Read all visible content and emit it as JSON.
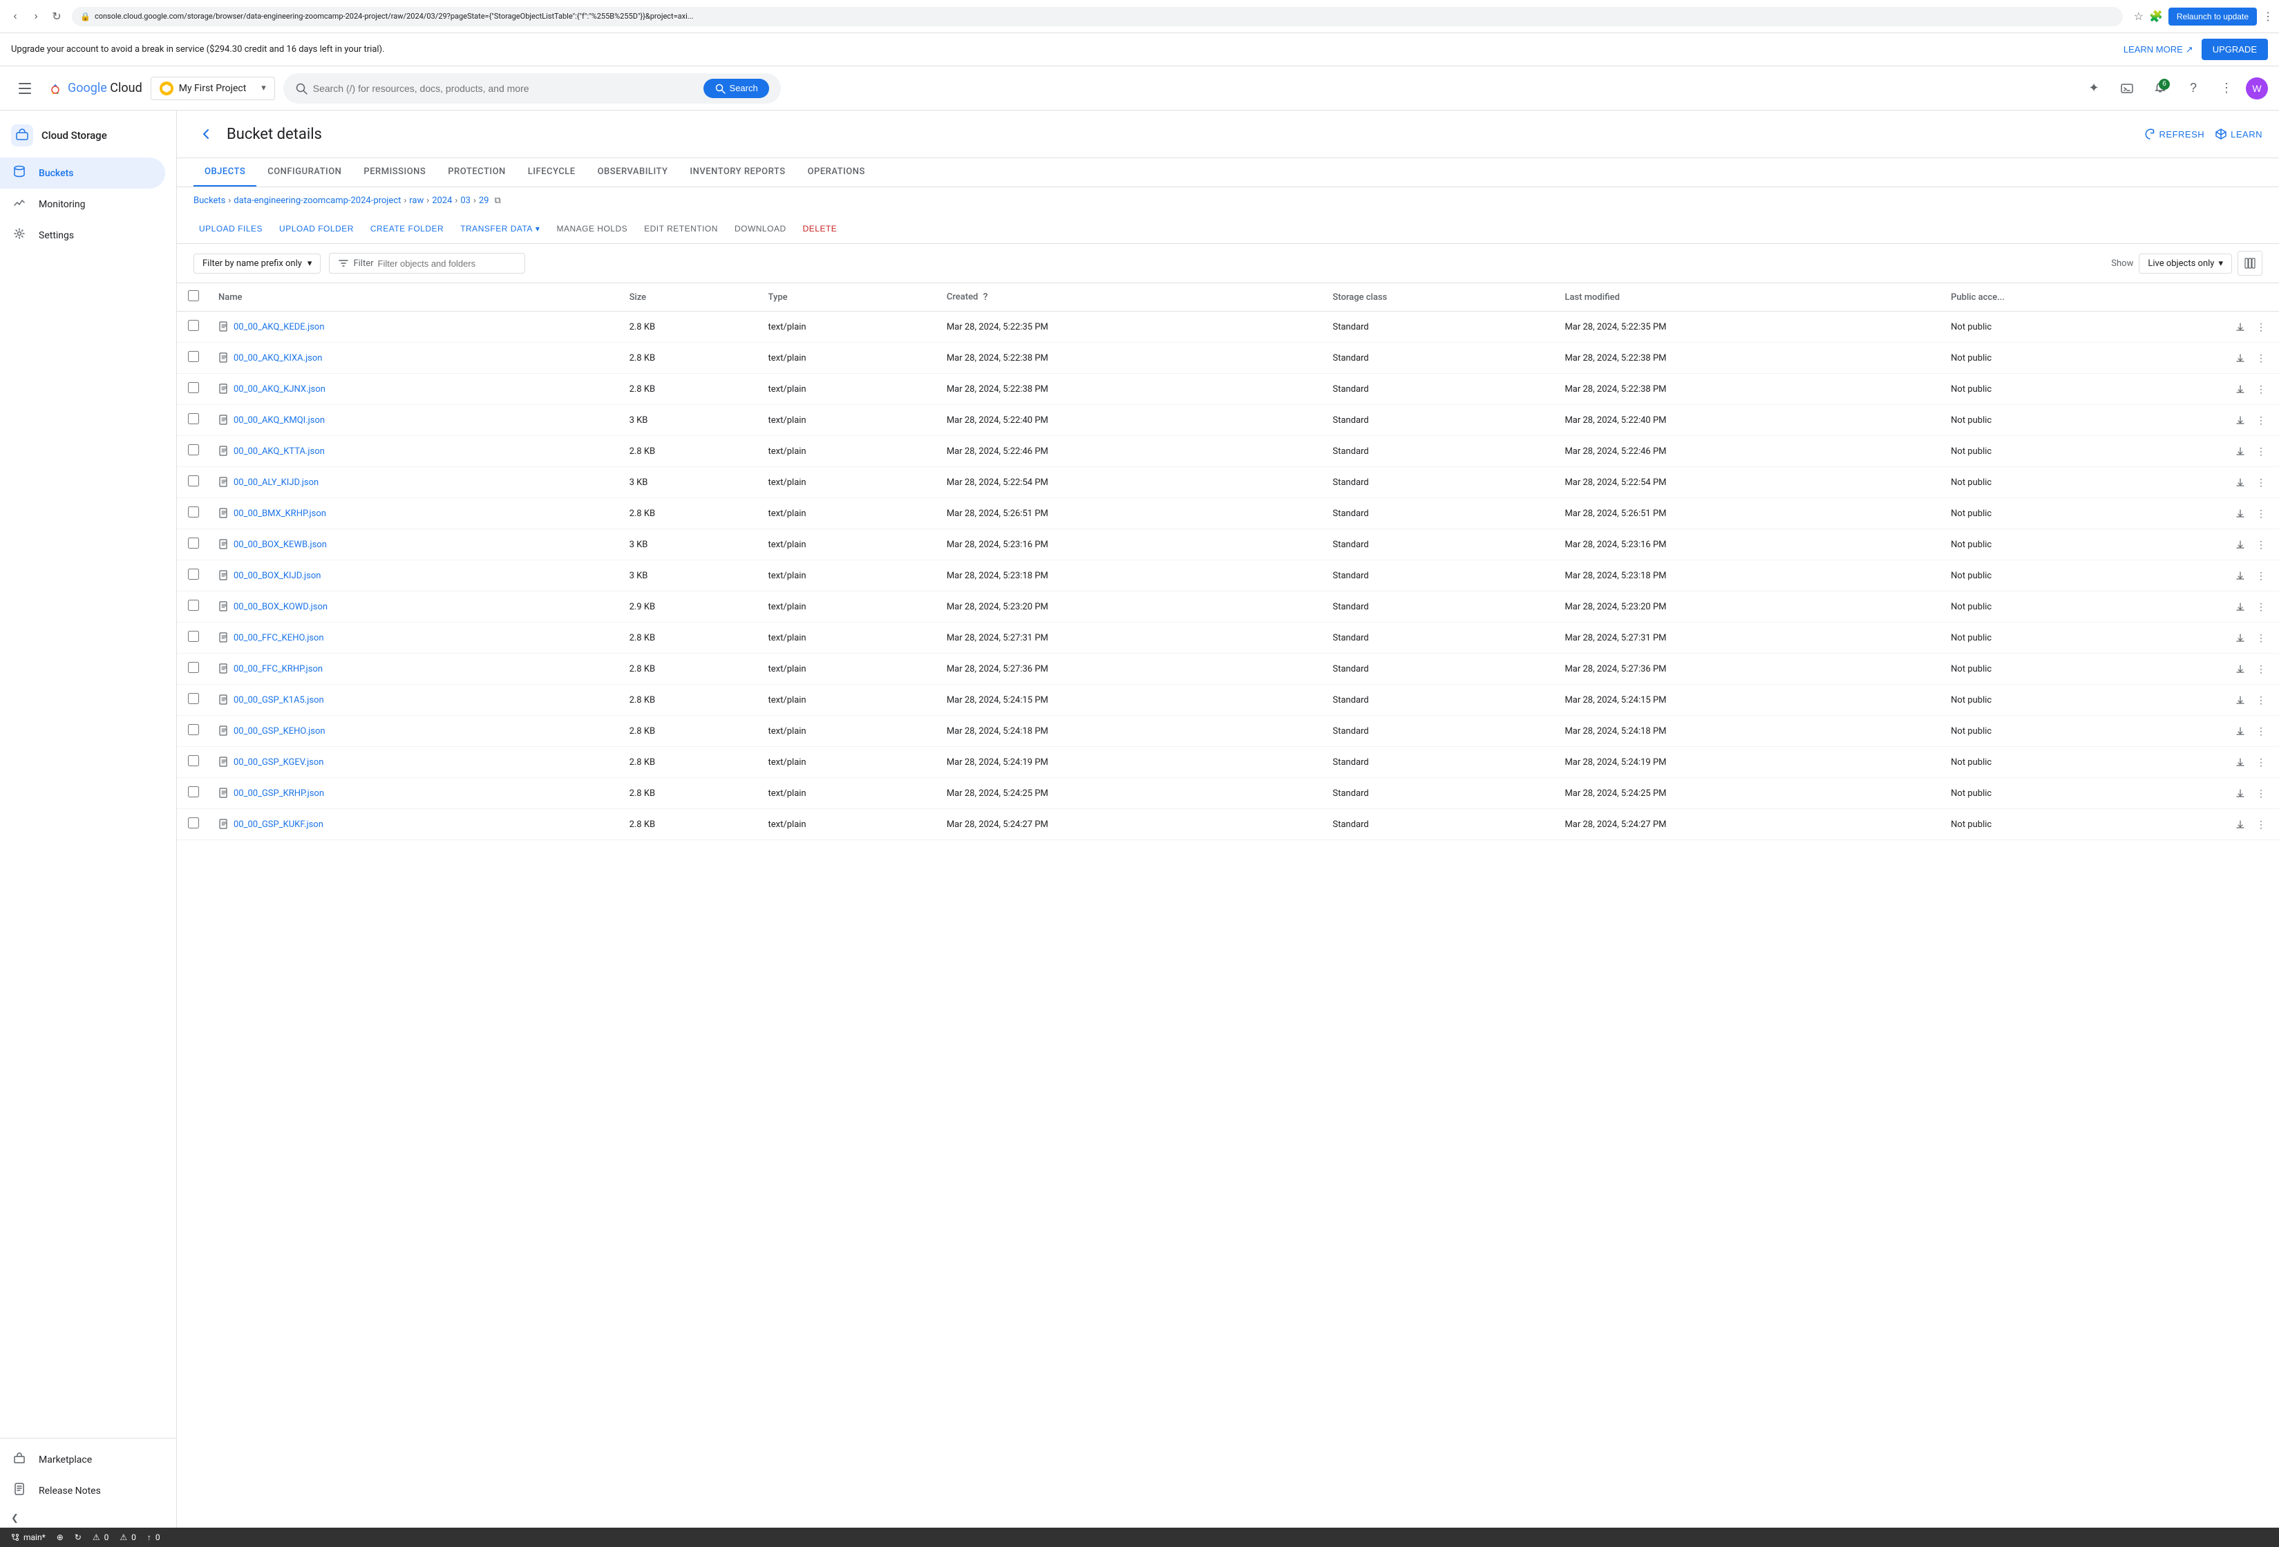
{
  "browser": {
    "url": "console.cloud.google.com/storage/browser/data-engineering-zoomcamp-2024-project/raw/2024/03/29?pageState={\"StorageObjectListTable\":{\"f\":\"%255B%255D\"}}&project=axi...",
    "relaunch_label": "Relaunch to update"
  },
  "banner": {
    "text": "Upgrade your account to avoid a break in service ($294.30 credit and 16 days left in your trial).",
    "learn_more": "LEARN MORE",
    "upgrade": "UPGRADE"
  },
  "header": {
    "logo_google": "Google",
    "logo_cloud": " Cloud",
    "project_name": "My First Project",
    "search_placeholder": "Search (/) for resources, docs, products, and more",
    "search_label": "Search",
    "notification_count": "6"
  },
  "sidebar": {
    "service_title": "Cloud Storage",
    "items": [
      {
        "id": "buckets",
        "label": "Buckets",
        "icon": "🪣",
        "active": true
      },
      {
        "id": "monitoring",
        "label": "Monitoring",
        "icon": "📊",
        "active": false
      },
      {
        "id": "settings",
        "label": "Settings",
        "icon": "⚙️",
        "active": false
      }
    ],
    "bottom_items": [
      {
        "id": "marketplace",
        "label": "Marketplace",
        "icon": "🏪"
      },
      {
        "id": "release-notes",
        "label": "Release Notes",
        "icon": "📋"
      }
    ],
    "collapse_icon": "❮"
  },
  "page": {
    "title": "Bucket details",
    "back_label": "←",
    "refresh_label": "REFRESH",
    "learn_label": "LEARN"
  },
  "tabs": [
    {
      "id": "objects",
      "label": "OBJECTS",
      "active": true
    },
    {
      "id": "configuration",
      "label": "CONFIGURATION",
      "active": false
    },
    {
      "id": "permissions",
      "label": "PERMISSIONS",
      "active": false
    },
    {
      "id": "protection",
      "label": "PROTECTION",
      "active": false
    },
    {
      "id": "lifecycle",
      "label": "LIFECYCLE",
      "active": false
    },
    {
      "id": "observability",
      "label": "OBSERVABILITY",
      "active": false
    },
    {
      "id": "inventory-reports",
      "label": "INVENTORY REPORTS",
      "active": false
    },
    {
      "id": "operations",
      "label": "OPERATIONS",
      "active": false
    }
  ],
  "breadcrumb": {
    "items": [
      "Buckets",
      "data-engineering-zoomcamp-2024-project",
      "raw",
      "2024",
      "03",
      "29"
    ],
    "copy_icon": "⧉"
  },
  "toolbar": {
    "buttons": [
      {
        "id": "upload-files",
        "label": "UPLOAD FILES",
        "type": "primary"
      },
      {
        "id": "upload-folder",
        "label": "UPLOAD FOLDER",
        "type": "primary"
      },
      {
        "id": "create-folder",
        "label": "CREATE FOLDER",
        "type": "primary"
      },
      {
        "id": "transfer-data",
        "label": "TRANSFER DATA",
        "type": "primary-dropdown"
      },
      {
        "id": "manage-holds",
        "label": "MANAGE HOLDS",
        "type": "secondary"
      },
      {
        "id": "edit-retention",
        "label": "EDIT RETENTION",
        "type": "secondary"
      },
      {
        "id": "download",
        "label": "DOWNLOAD",
        "type": "secondary"
      },
      {
        "id": "delete",
        "label": "DELETE",
        "type": "danger"
      }
    ]
  },
  "filter": {
    "prefix_label": "Filter by name prefix only",
    "filter_placeholder": "Filter objects and folders",
    "show_label": "Show",
    "live_objects_label": "Live objects only",
    "columns_icon": "⊞"
  },
  "table": {
    "columns": [
      "Name",
      "Size",
      "Type",
      "Created",
      "Storage class",
      "Last modified",
      "Public acce"
    ],
    "rows": [
      {
        "name": "00_00_AKQ_KEDE.json",
        "size": "2.8 KB",
        "type": "text/plain",
        "created": "Mar 28, 2024, 5:22:35 PM",
        "storage_class": "Standard",
        "last_modified": "Mar 28, 2024, 5:22:35 PM",
        "public_access": "Not public"
      },
      {
        "name": "00_00_AKQ_KIXA.json",
        "size": "2.8 KB",
        "type": "text/plain",
        "created": "Mar 28, 2024, 5:22:38 PM",
        "storage_class": "Standard",
        "last_modified": "Mar 28, 2024, 5:22:38 PM",
        "public_access": "Not public"
      },
      {
        "name": "00_00_AKQ_KJNX.json",
        "size": "2.8 KB",
        "type": "text/plain",
        "created": "Mar 28, 2024, 5:22:38 PM",
        "storage_class": "Standard",
        "last_modified": "Mar 28, 2024, 5:22:38 PM",
        "public_access": "Not public"
      },
      {
        "name": "00_00_AKQ_KMQI.json",
        "size": "3 KB",
        "type": "text/plain",
        "created": "Mar 28, 2024, 5:22:40 PM",
        "storage_class": "Standard",
        "last_modified": "Mar 28, 2024, 5:22:40 PM",
        "public_access": "Not public"
      },
      {
        "name": "00_00_AKQ_KTTA.json",
        "size": "2.8 KB",
        "type": "text/plain",
        "created": "Mar 28, 2024, 5:22:46 PM",
        "storage_class": "Standard",
        "last_modified": "Mar 28, 2024, 5:22:46 PM",
        "public_access": "Not public"
      },
      {
        "name": "00_00_ALY_KIJD.json",
        "size": "3 KB",
        "type": "text/plain",
        "created": "Mar 28, 2024, 5:22:54 PM",
        "storage_class": "Standard",
        "last_modified": "Mar 28, 2024, 5:22:54 PM",
        "public_access": "Not public"
      },
      {
        "name": "00_00_BMX_KRHP.json",
        "size": "2.8 KB",
        "type": "text/plain",
        "created": "Mar 28, 2024, 5:26:51 PM",
        "storage_class": "Standard",
        "last_modified": "Mar 28, 2024, 5:26:51 PM",
        "public_access": "Not public"
      },
      {
        "name": "00_00_BOX_KEWB.json",
        "size": "3 KB",
        "type": "text/plain",
        "created": "Mar 28, 2024, 5:23:16 PM",
        "storage_class": "Standard",
        "last_modified": "Mar 28, 2024, 5:23:16 PM",
        "public_access": "Not public"
      },
      {
        "name": "00_00_BOX_KIJD.json",
        "size": "3 KB",
        "type": "text/plain",
        "created": "Mar 28, 2024, 5:23:18 PM",
        "storage_class": "Standard",
        "last_modified": "Mar 28, 2024, 5:23:18 PM",
        "public_access": "Not public"
      },
      {
        "name": "00_00_BOX_KOWD.json",
        "size": "2.9 KB",
        "type": "text/plain",
        "created": "Mar 28, 2024, 5:23:20 PM",
        "storage_class": "Standard",
        "last_modified": "Mar 28, 2024, 5:23:20 PM",
        "public_access": "Not public"
      },
      {
        "name": "00_00_FFC_KEHO.json",
        "size": "2.8 KB",
        "type": "text/plain",
        "created": "Mar 28, 2024, 5:27:31 PM",
        "storage_class": "Standard",
        "last_modified": "Mar 28, 2024, 5:27:31 PM",
        "public_access": "Not public"
      },
      {
        "name": "00_00_FFC_KRHP.json",
        "size": "2.8 KB",
        "type": "text/plain",
        "created": "Mar 28, 2024, 5:27:36 PM",
        "storage_class": "Standard",
        "last_modified": "Mar 28, 2024, 5:27:36 PM",
        "public_access": "Not public"
      },
      {
        "name": "00_00_GSP_K1A5.json",
        "size": "2.8 KB",
        "type": "text/plain",
        "created": "Mar 28, 2024, 5:24:15 PM",
        "storage_class": "Standard",
        "last_modified": "Mar 28, 2024, 5:24:15 PM",
        "public_access": "Not public"
      },
      {
        "name": "00_00_GSP_KEHO.json",
        "size": "2.8 KB",
        "type": "text/plain",
        "created": "Mar 28, 2024, 5:24:18 PM",
        "storage_class": "Standard",
        "last_modified": "Mar 28, 2024, 5:24:18 PM",
        "public_access": "Not public"
      },
      {
        "name": "00_00_GSP_KGEV.json",
        "size": "2.8 KB",
        "type": "text/plain",
        "created": "Mar 28, 2024, 5:24:19 PM",
        "storage_class": "Standard",
        "last_modified": "Mar 28, 2024, 5:24:19 PM",
        "public_access": "Not public"
      },
      {
        "name": "00_00_GSP_KRHP.json",
        "size": "2.8 KB",
        "type": "text/plain",
        "created": "Mar 28, 2024, 5:24:25 PM",
        "storage_class": "Standard",
        "last_modified": "Mar 28, 2024, 5:24:25 PM",
        "public_access": "Not public"
      },
      {
        "name": "00_00_GSP_KUKF.json",
        "size": "2.8 KB",
        "type": "text/plain",
        "created": "Mar 28, 2024, 5:24:27 PM",
        "storage_class": "Standard",
        "last_modified": "Mar 28, 2024, 5:24:27 PM",
        "public_access": "Not public"
      }
    ]
  },
  "status_bar": {
    "branch": "main*",
    "icons": [
      "⊕",
      "↻",
      "⚠ 0",
      "⚠ 0",
      "↑ 0"
    ]
  }
}
